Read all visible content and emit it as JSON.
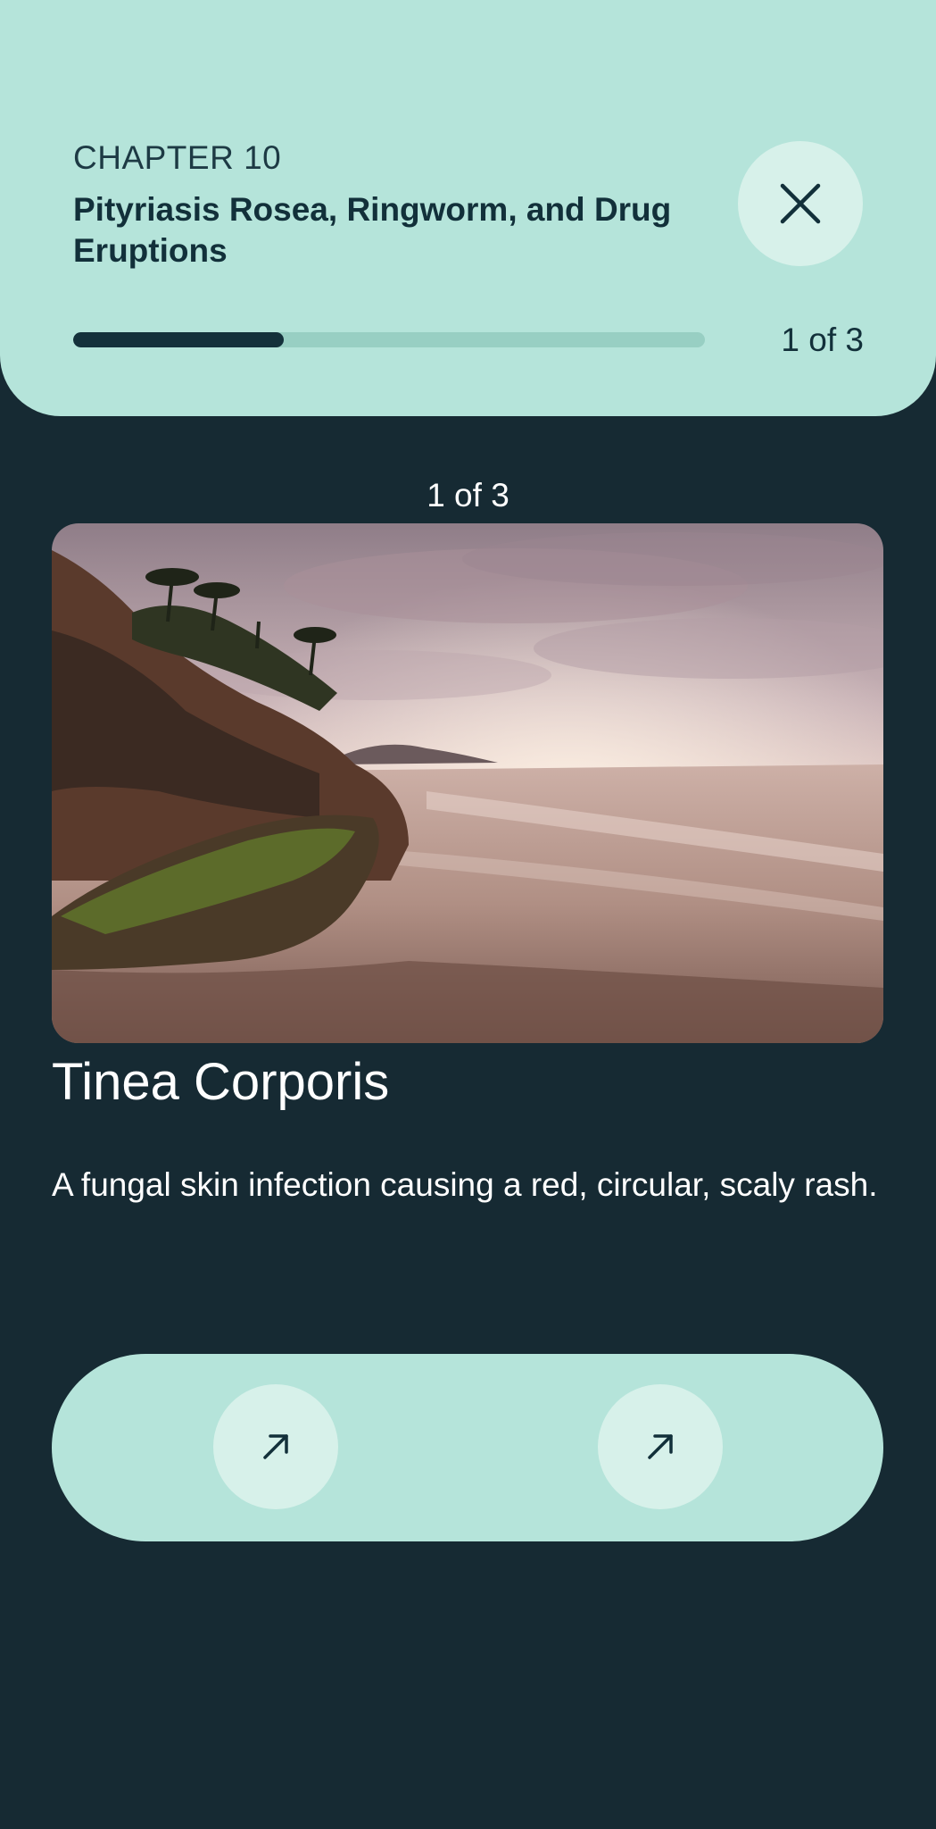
{
  "header": {
    "chapter_label": "CHAPTER 10",
    "chapter_title": "Pityriasis Rosea, Ringworm, and Drug Eruptions",
    "close_icon": "close-icon",
    "progress": {
      "current": 1,
      "total": 3,
      "fraction": 0.333,
      "label": "1 of 3"
    }
  },
  "slide": {
    "counter": "1 of 3",
    "image_icon": "beach-photo",
    "title": "Tinea Corporis",
    "description": "A fungal skin infection causing a red, circular, scaly rash."
  },
  "actions": {
    "left_icon": "arrow-up-right-icon",
    "right_icon": "arrow-up-right-icon"
  },
  "colors": {
    "background": "#162a33",
    "accent": "#b5e4da",
    "button": "#d7f1ea",
    "progress_fill": "#14313b"
  }
}
